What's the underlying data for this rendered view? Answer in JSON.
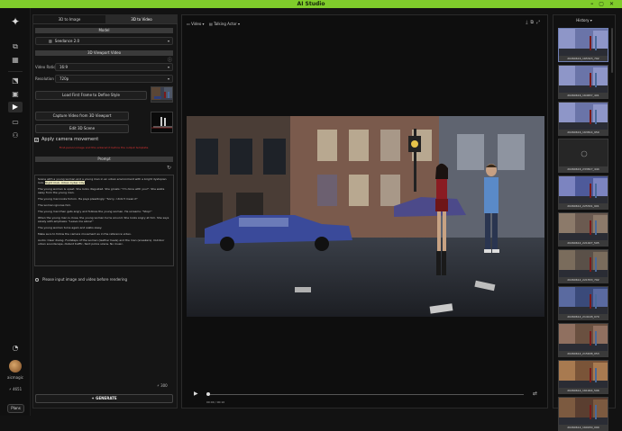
{
  "app": {
    "title": "AI Studio"
  },
  "rail": {
    "user_name": "aicmagic",
    "credits": "4651",
    "plans_label": "Plans"
  },
  "left_panel": {
    "tabs": [
      "3D to Image",
      "3D to Video"
    ],
    "active_tab": 1,
    "model_header": "Model",
    "model_value": "Seedance 2.0",
    "viewport_header": "3D Viewport Video",
    "video_ratio_label": "Video Ratio",
    "video_ratio_value": "16:9",
    "resolution_label": "Resolution",
    "resolution_value": "720p",
    "load_first_frame_label": "Load First Frame to Define Style",
    "capture_video_label": "Capture Video from 3D Viewport",
    "edit_scene_label": "Edit 3D Scene",
    "apply_camera_label": "Apply camera movement",
    "apply_camera_checked": true,
    "warning_text": "First-person image and this entered it before the output template.",
    "prompt_header": "Prompt",
    "prompt_lines": [
      "Scene with a young woman and a young man in an urban environment with a bright dystopian look.",
      "The young woman is upset. She looks disgusted. She growls: \"I'm done with you!\". She walks away from the young man.",
      "The young man looks forlorn. He pays pleadingly: \"Sorry, I didn't mean it\"",
      "The woman ignores him.",
      "The young man then gets angry and follows the young woman. He screams: \"Stop!\"",
      "When the young man is close, the young woman turns around. She looks angry at him. She says slowly with emphasis: \"Leave me alone!\"",
      "The young woman turns again and walks away.",
      "Make sure to follow the camera movement as in the reference video.",
      "Audio: Clear dialog. Footsteps of the women (leather heels) and the man (sneakers). Outdoor urban soundscape, distant traffic, faint police sirens. No music."
    ],
    "prompt_highlight": "Night Club. Urban Cyber City",
    "render_hint": "Please input image and video before rendering",
    "char_count": "300",
    "generate_label": "GENERATE"
  },
  "viewer": {
    "video_menu": "Video",
    "talking_actor_menu": "Talking Actor",
    "time": "00:00 / 00:10",
    "progress": 0
  },
  "history": {
    "title": "History",
    "items": [
      "20260616_165323_702",
      "20260616_164657_401",
      "20260616_163814_959",
      "20260616_233817_444",
      "20260614_225301_901",
      "20260614_221927_505",
      "20260614_221553_702",
      "20260614_214148_070",
      "20260614_215638_053",
      "20260614_161944_596",
      "20260614_160030_090"
    ],
    "selected_index": 0
  },
  "colors": {
    "accent": "#7fcc2b",
    "panel": "#151515",
    "background": "#121212"
  }
}
